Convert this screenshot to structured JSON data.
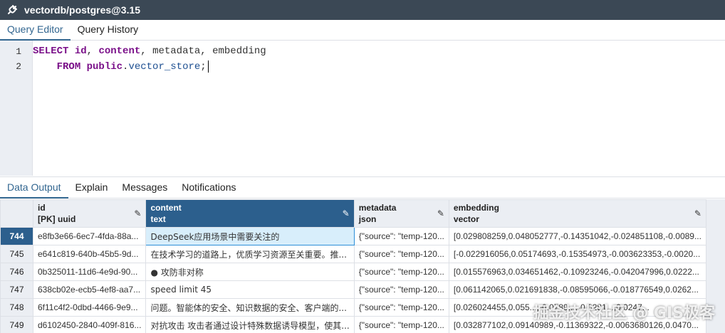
{
  "window": {
    "title": "vectordb/postgres@3.15"
  },
  "editor_tabs": [
    "Query Editor",
    "Query History"
  ],
  "editor": {
    "line_numbers": [
      "1",
      "2"
    ],
    "line1": {
      "kw1": "SELECT",
      "col1": "id",
      "comma1": ", ",
      "col2": "content",
      "rest": ", metadata, embedding"
    },
    "line2": {
      "indent": "    ",
      "kw": "FROM",
      "schema": "public",
      "dot": ".",
      "table": "vector_store",
      "semi": ";"
    }
  },
  "output_tabs": [
    "Data Output",
    "Explain",
    "Messages",
    "Notifications"
  ],
  "grid": {
    "columns": [
      {
        "name": "id",
        "type": "[PK] uuid"
      },
      {
        "name": "content",
        "type": "text"
      },
      {
        "name": "metadata",
        "type": "json"
      },
      {
        "name": "embedding",
        "type": "vector"
      }
    ],
    "rows": [
      {
        "n": "744",
        "id": "e8fb3e66-6ec7-4fda-88a...",
        "content": "DeepSeek应用场景中需要关注的",
        "metadata": "{\"source\": \"temp-120...",
        "embedding": "[0.029808259,0.048052777,-0.14351042,-0.024851108,-0.0089..."
      },
      {
        "n": "745",
        "id": "e641c819-640b-45b5-9d...",
        "content": "在技术学习的道路上，优质学习资源至关重要。推...",
        "metadata": "{\"source\": \"temp-120...",
        "embedding": "[-0.022916056,0.05174693,-0.15354973,-0.003623353,-0.0020..."
      },
      {
        "n": "746",
        "id": "0b325011-11d6-4e9d-90...",
        "content": "● 攻防非对称",
        "metadata": "{\"source\": \"temp-120...",
        "embedding": "[0.015576963,0.034651462,-0.10923246,-0.042047996,0.0222..."
      },
      {
        "n": "747",
        "id": "638cb02e-ecb5-4ef8-aa7...",
        "content": "speed limit 45",
        "metadata": "{\"source\": \"temp-120...",
        "embedding": "[0.061142065,0.021691838,-0.08595066,-0.018776549,0.0262..."
      },
      {
        "n": "748",
        "id": "6f11c4f2-0dbd-4466-9e9...",
        "content": "问题。智能体的安全、知识数据的安全、客户端的...",
        "metadata": "{\"source\": \"temp-120...",
        "embedding": "[0.026024455,0.055...,-0.0789...,-0.0281...,0.0247..."
      },
      {
        "n": "749",
        "id": "d6102450-2840-409f-816...",
        "content": "对抗攻击 攻击者通过设计特殊数据诱导模型，使其...",
        "metadata": "{\"source\": \"temp-120...",
        "embedding": "[0.032877102,0.09140989,-0.11369322,-0.0063680126,0.0470..."
      }
    ]
  },
  "watermark": "掘金技术社区 @ GIS极客"
}
